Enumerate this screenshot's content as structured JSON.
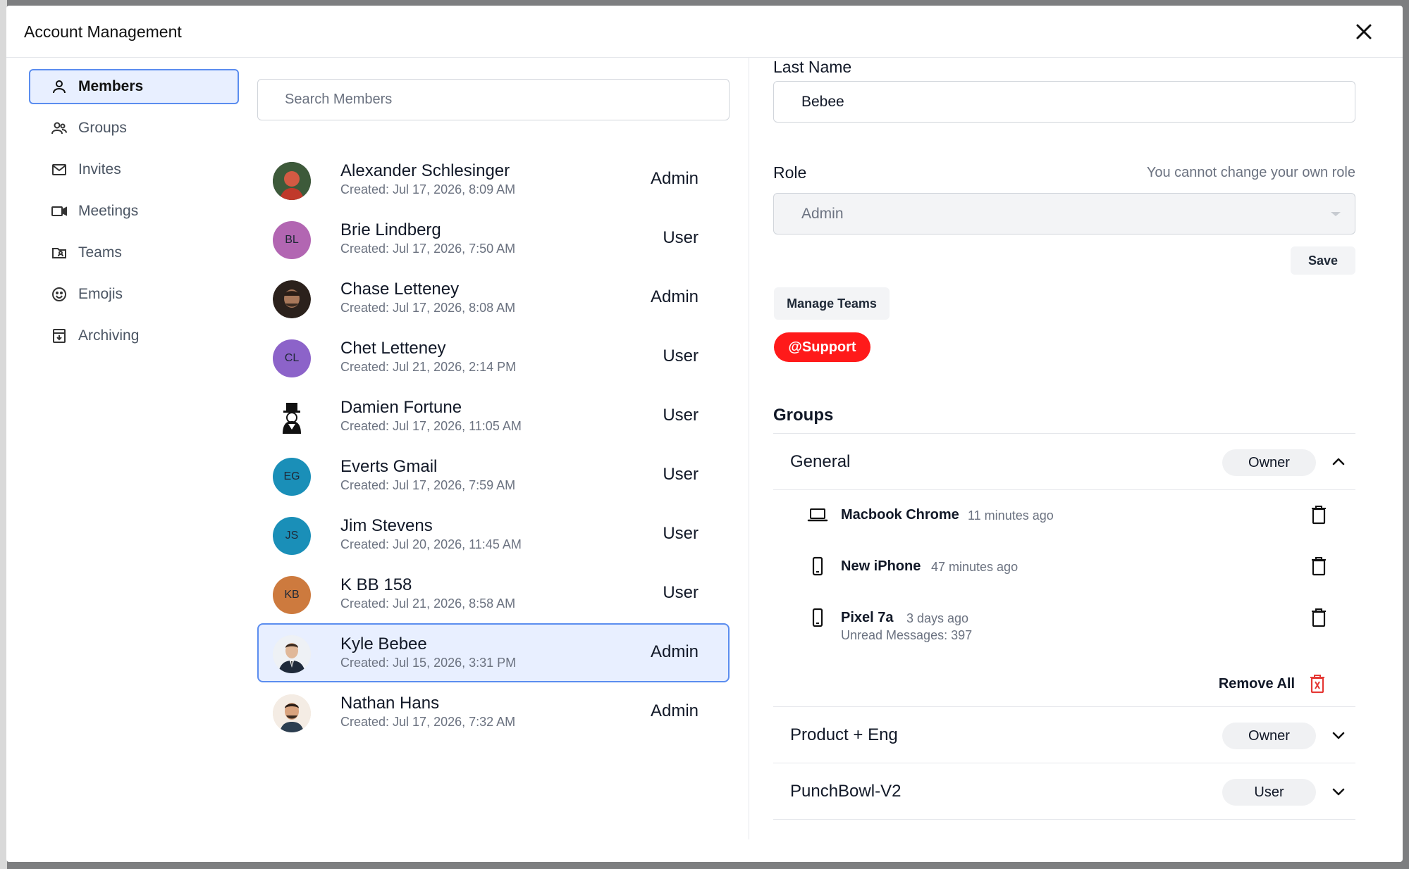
{
  "window": {
    "title": "Account Management"
  },
  "sidebar": {
    "items": [
      {
        "label": "Members",
        "icon": "person-icon",
        "active": true
      },
      {
        "label": "Groups",
        "icon": "people-icon"
      },
      {
        "label": "Invites",
        "icon": "envelope-icon"
      },
      {
        "label": "Meetings",
        "icon": "video-camera-icon"
      },
      {
        "label": "Teams",
        "icon": "team-card-icon"
      },
      {
        "label": "Emojis",
        "icon": "smiley-icon"
      },
      {
        "label": "Archiving",
        "icon": "archive-box-icon"
      }
    ]
  },
  "search": {
    "placeholder": "Search Members"
  },
  "members": [
    {
      "name": "Alexander Schlesinger",
      "created": "Created: Jul 17, 2026, 8:09 AM",
      "role": "Admin",
      "initials": "",
      "avatar_color": "#c0392b"
    },
    {
      "name": "Brie Lindberg",
      "created": "Created: Jul 17, 2026, 7:50 AM",
      "role": "User",
      "initials": "BL",
      "avatar_color": "#b266b2"
    },
    {
      "name": "Chase Letteney",
      "created": "Created: Jul 17, 2026, 8:08 AM",
      "role": "Admin",
      "initials": "",
      "avatar_color": "#3b2f2a"
    },
    {
      "name": "Chet Letteney",
      "created": "Created: Jul 21, 2026, 2:14 PM",
      "role": "User",
      "initials": "CL",
      "avatar_color": "#8c63c9"
    },
    {
      "name": "Damien Fortune",
      "created": "Created: Jul 17, 2026, 11:05 AM",
      "role": "User",
      "initials": "",
      "avatar_color": "#ffffff"
    },
    {
      "name": "Everts Gmail",
      "created": "Created: Jul 17, 2026, 7:59 AM",
      "role": "User",
      "initials": "EG",
      "avatar_color": "#1a8fb8"
    },
    {
      "name": "Jim Stevens",
      "created": "Created: Jul 20, 2026, 11:45 AM",
      "role": "User",
      "initials": "JS",
      "avatar_color": "#1a8fb8"
    },
    {
      "name": "K BB 158",
      "created": "Created: Jul 21, 2026, 8:58 AM",
      "role": "User",
      "initials": "KB",
      "avatar_color": "#cd7a3e"
    },
    {
      "name": "Kyle Bebee",
      "created": "Created: Jul 15, 2026, 3:31 PM",
      "role": "Admin",
      "initials": "",
      "avatar_color": "#e9eef5",
      "selected": true
    },
    {
      "name": "Nathan Hans",
      "created": "Created: Jul 17, 2026, 7:32 AM",
      "role": "Admin",
      "initials": "",
      "avatar_color": "#f3e3d3"
    }
  ],
  "detail": {
    "last_name_label": "Last Name",
    "last_name_value": "Bebee",
    "role_label": "Role",
    "role_hint": "You cannot change your own role",
    "role_value": "Admin",
    "save_label": "Save",
    "manage_teams_label": "Manage Teams",
    "team_tag": "@Support",
    "team_tag_color": "#ff1a1a",
    "groups_title": "Groups",
    "groups": [
      {
        "name": "General",
        "badge": "Owner",
        "expanded": true,
        "devices": [
          {
            "name": "Macbook Chrome",
            "time": "11 minutes ago",
            "icon": "laptop-icon",
            "sub": ""
          },
          {
            "name": "New iPhone",
            "time": "47 minutes ago",
            "icon": "phone-icon",
            "sub": ""
          },
          {
            "name": "Pixel 7a",
            "time": "3 days ago",
            "icon": "phone-icon",
            "sub": "Unread Messages: 397"
          }
        ],
        "remove_all_label": "Remove All"
      },
      {
        "name": "Product + Eng",
        "badge": "Owner",
        "expanded": false
      },
      {
        "name": "PunchBowl-V2",
        "badge": "User",
        "expanded": false
      }
    ]
  },
  "colors": {
    "accent": "#5b8def",
    "accent_bg": "#e8efff",
    "danger": "#e53935"
  }
}
